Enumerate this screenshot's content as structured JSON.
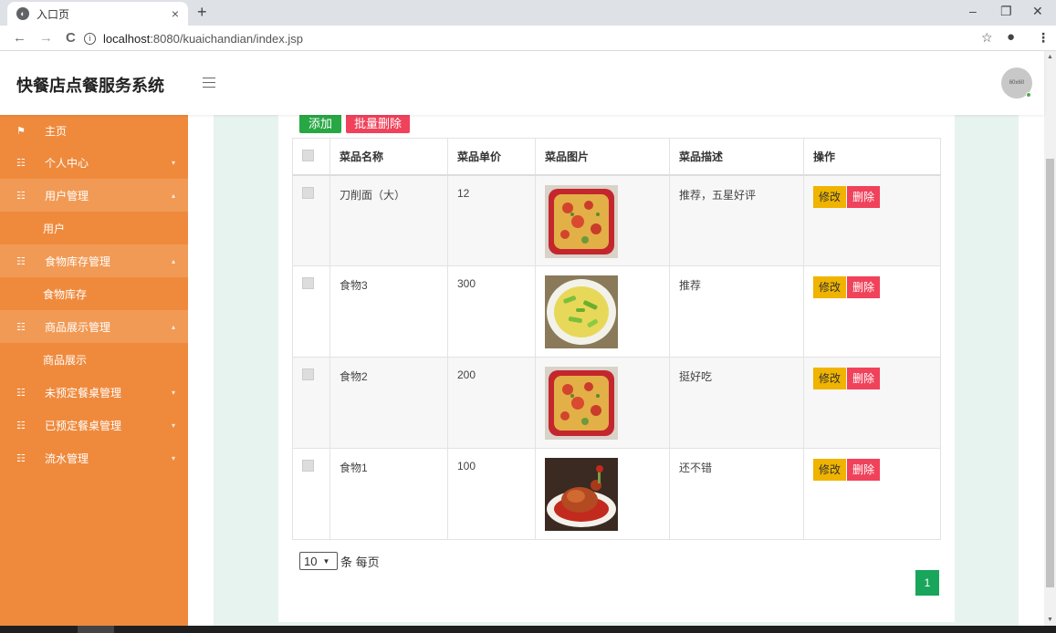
{
  "browser": {
    "tab_title": "入口页",
    "tab_close": "×",
    "new_tab": "+",
    "url_host": "localhost",
    "url_rest": ":8080/kuaichandian/index.jsp",
    "back": "←",
    "forward": "→",
    "reload": "C",
    "star": "☆",
    "menu": "⋮",
    "minimize": "–",
    "restore": "❐",
    "close": "✕"
  },
  "header": {
    "brand": "快餐店点餐服务系统",
    "avatar_text": "60x60"
  },
  "sidebar": {
    "items": [
      {
        "label": "主页",
        "icon": "flag-icon"
      },
      {
        "label": "个人中心",
        "icon": "grid-icon"
      },
      {
        "label": "用户管理",
        "icon": "grid-icon"
      },
      {
        "label": "用户"
      },
      {
        "label": "食物库存管理",
        "icon": "grid-icon"
      },
      {
        "label": "食物库存"
      },
      {
        "label": "商品展示管理",
        "icon": "grid-icon"
      },
      {
        "label": "商品展示"
      },
      {
        "label": "未预定餐桌管理",
        "icon": "grid-icon"
      },
      {
        "label": "已预定餐桌管理",
        "icon": "grid-icon"
      },
      {
        "label": "流水管理",
        "icon": "grid-icon"
      }
    ]
  },
  "toolbar": {
    "add_label": "添加",
    "bulk_delete_label": "批量删除"
  },
  "table": {
    "headers": [
      "菜品名称",
      "菜品单价",
      "菜品图片",
      "菜品描述",
      "操作"
    ],
    "rows": [
      {
        "name": "刀削面（大）",
        "price": "12",
        "desc": "推荐，五星好评",
        "image": "tomato-egg-dish"
      },
      {
        "name": "食物3",
        "price": "300",
        "desc": "推荐",
        "image": "green-pepper-egg-dish"
      },
      {
        "name": "食物2",
        "price": "200",
        "desc": "挺好吃",
        "image": "tomato-egg-dish"
      },
      {
        "name": "食物1",
        "price": "100",
        "desc": "还不错",
        "image": "roast-duck-dish"
      }
    ],
    "edit_label": "修改",
    "delete_label": "删除"
  },
  "pagination": {
    "page_size": "10",
    "page_size_suffix": "条 每页",
    "current_page": "1"
  },
  "colors": {
    "sidebar": "#ef8a3d",
    "add_button": "#28a745",
    "delete_button": "#f0425b",
    "edit_button": "#f0b400",
    "page_active": "#19a55b",
    "main_background": "#e7f3ee"
  }
}
